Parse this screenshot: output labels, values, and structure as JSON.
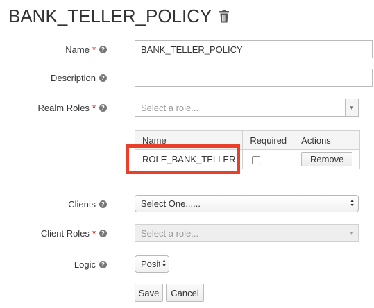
{
  "page": {
    "title": "BANK_TELLER_POLICY"
  },
  "icons": {
    "delete": "trash-icon",
    "help": "question-circle-icon"
  },
  "colors": {
    "required": "#cc0000",
    "highlight": "#e8402a"
  },
  "form": {
    "name": {
      "label": "Name",
      "required": "*",
      "value": "BANK_TELLER_POLICY"
    },
    "description": {
      "label": "Description",
      "value": ""
    },
    "realm_roles": {
      "label": "Realm Roles",
      "required": "*",
      "placeholder": "Select a role...",
      "table": {
        "headers": [
          "Name",
          "Required",
          "Actions"
        ],
        "rows": [
          {
            "name": "ROLE_BANK_TELLER",
            "required": false,
            "action": "Remove"
          }
        ]
      }
    },
    "clients": {
      "label": "Clients",
      "value": "Select One......"
    },
    "client_roles": {
      "label": "Client Roles",
      "required": "*",
      "placeholder": "Select a role..."
    },
    "logic": {
      "label": "Logic",
      "value": "Posit"
    },
    "save_label": "Save",
    "cancel_label": "Cancel"
  }
}
